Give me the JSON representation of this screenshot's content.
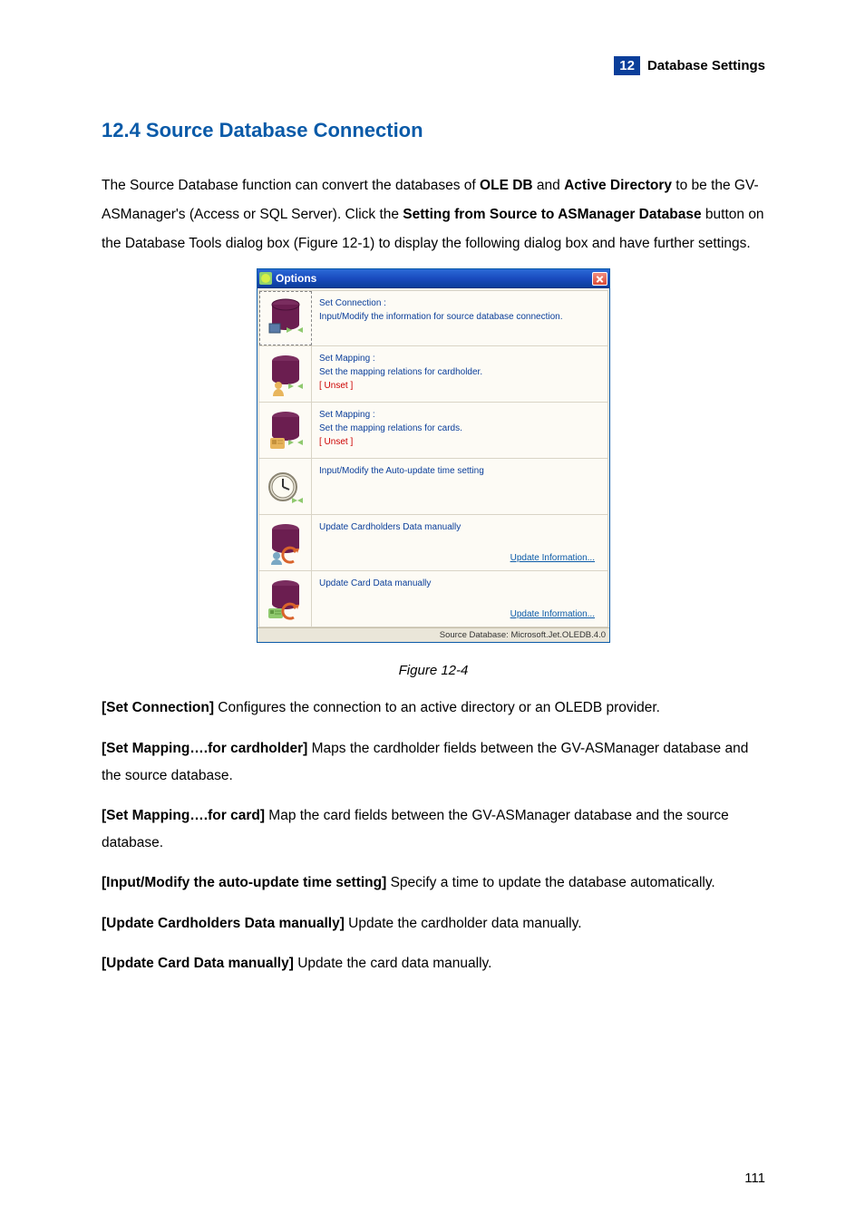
{
  "header": {
    "badge": "12",
    "text": "Database Settings"
  },
  "section_title": "12.4   Source Database Connection",
  "intro": {
    "t1": "The Source Database function can convert the databases of ",
    "b1": "OLE DB",
    "t2": " and ",
    "b2": "Active Directory",
    "t3": " to be the GV-ASManager's (Access or SQL Server). Click the ",
    "b3": "Setting from Source to ASManager Database",
    "t4": " button on the Database Tools dialog box (Figure 12-1) to display the following dialog box and have further settings."
  },
  "dialog": {
    "title": "Options",
    "rows": [
      {
        "l1": "Set Connection :",
        "l2": "Input/Modify the information for source database connection.",
        "red": "",
        "link": ""
      },
      {
        "l1": "Set Mapping :",
        "l2": "Set the mapping relations for cardholder.",
        "red": "[ Unset ]",
        "link": ""
      },
      {
        "l1": "Set Mapping :",
        "l2": "Set the mapping relations for cards.",
        "red": "[ Unset ]",
        "link": ""
      },
      {
        "l1": "Input/Modify the Auto-update time setting",
        "l2": "",
        "red": "",
        "link": ""
      },
      {
        "l1": "Update Cardholders Data manually",
        "l2": "",
        "red": "",
        "link": "Update Information..."
      },
      {
        "l1": "Update Card Data manually",
        "l2": "",
        "red": "",
        "link": "Update Information..."
      }
    ],
    "status": "Source Database: Microsoft.Jet.OLEDB.4.0"
  },
  "figure_caption": "Figure 12-4",
  "descriptions": {
    "d1b": "[Set Connection]",
    "d1t": " Configures the connection to an active directory or an OLEDB provider.",
    "d2b": "[Set Mapping….for cardholder]",
    "d2t": " Maps the cardholder fields between the GV-ASManager database and the source database.",
    "d3b": "[Set Mapping….for card]",
    "d3t": " Map the card fields between the GV-ASManager database and the source database.",
    "d4b": "[Input/Modify the auto-update time setting]",
    "d4t": " Specify a time to update the database automatically.",
    "d5b": "[Update Cardholders Data manually]",
    "d5t": " Update the cardholder data manually.",
    "d6b": "[Update Card Data manually]",
    "d6t": " Update the card data manually."
  },
  "page_number": "111",
  "icons": {
    "db_base": "db-cylinder-icon",
    "db_person": "db-person-icon",
    "db_card": "db-card-icon",
    "clock": "clock-icon",
    "db_person_refresh": "db-person-refresh-icon",
    "db_card_refresh": "db-card-refresh-icon"
  }
}
